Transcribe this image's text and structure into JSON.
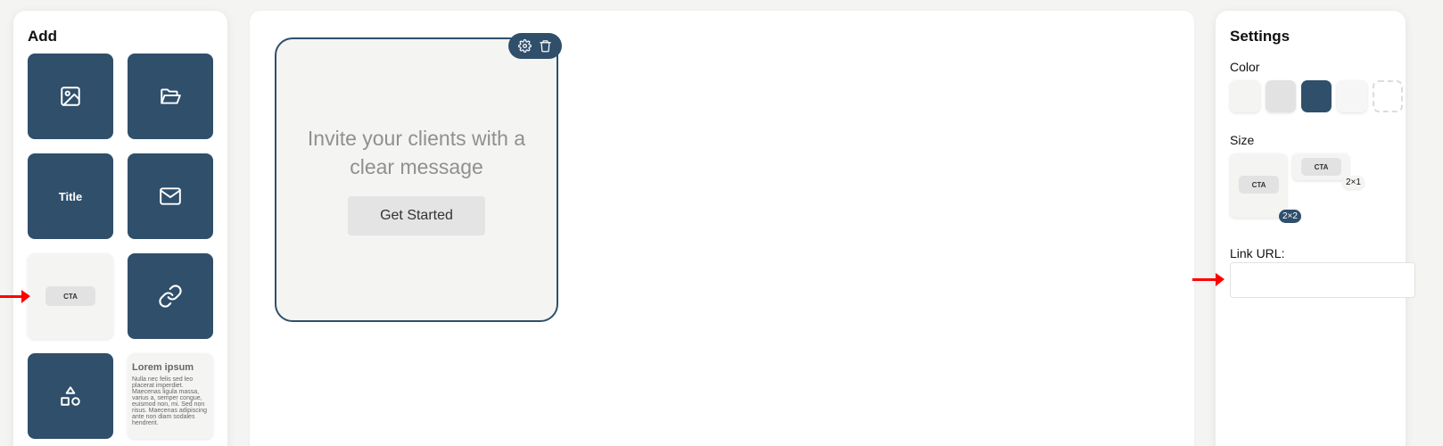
{
  "left_panel": {
    "title": "Add",
    "tiles": [
      {
        "icon": "image-icon"
      },
      {
        "icon": "folder-open-icon"
      },
      {
        "label": "Title"
      },
      {
        "icon": "mail-icon"
      },
      {
        "label": "CTA"
      },
      {
        "icon": "link-icon"
      },
      {
        "icon": "shapes-icon"
      },
      {
        "title": "Lorem ipsum",
        "body": "Nulla nec felis sed leo placerat imperdiet. Maecenas ligula massa, varius a, semper congue, euismod non, mi. Sed non risus. Maecenas adipiscing ante non diam sodales hendrerit."
      }
    ]
  },
  "canvas": {
    "card": {
      "message": "Invite your clients with a clear message",
      "button_label": "Get Started"
    }
  },
  "settings": {
    "title": "Settings",
    "color_label": "Color",
    "colors": [
      "#f4f4f2",
      "#e2e2e2",
      "#2f4f6b",
      "#f6f6f6",
      "transparent"
    ],
    "size_label": "Size",
    "sizes": [
      {
        "preview_label": "CTA",
        "badge": "2×2"
      },
      {
        "preview_label": "CTA",
        "badge": "2×1"
      }
    ],
    "link_label": "Link URL:",
    "link_value": ""
  },
  "colors": {
    "accent": "#2f4f6b",
    "arrow": "#ff0000"
  }
}
